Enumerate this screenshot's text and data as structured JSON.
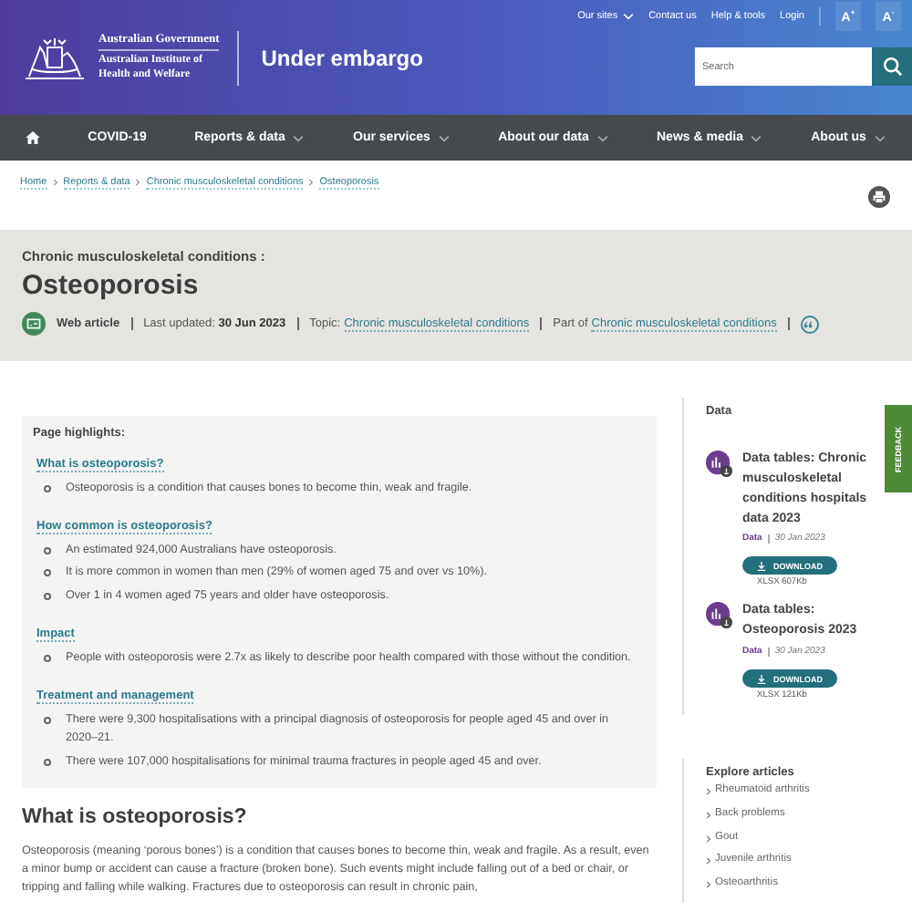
{
  "header": {
    "government": "Australian Government",
    "institute": "Australian Institute of Health and Welfare",
    "banner": "Under embargo",
    "utility_links": [
      {
        "label": "Our sites",
        "dropdown": true
      },
      {
        "label": "Contact us",
        "dropdown": false
      },
      {
        "label": "Help & tools",
        "dropdown": false
      },
      {
        "label": "Login",
        "dropdown": false
      }
    ],
    "text_size_buttons": [
      "A$^{+}$",
      "A$^{-}$"
    ],
    "search": {
      "placeholder": "Search"
    }
  },
  "nav": [
    {
      "label": "COVID-19",
      "dropdown": false
    },
    {
      "label": "Reports & data",
      "dropdown": true
    },
    {
      "label": "Our services",
      "dropdown": true
    },
    {
      "label": "About our data",
      "dropdown": true
    },
    {
      "label": "News & media",
      "dropdown": true
    },
    {
      "label": "About us",
      "dropdown": true
    }
  ],
  "breadcrumb": [
    "Home",
    "Reports & data",
    "Chronic musculoskeletal conditions",
    "Osteoporosis"
  ],
  "title_band": {
    "parent": "Chronic musculoskeletal conditions :",
    "title": "Osteoporosis",
    "type": "Web article",
    "updated_label": "Last updated:",
    "updated": "30 Jun 2023",
    "topic_label": "Topic:",
    "topic": "Chronic musculoskeletal conditions",
    "part_label": "Part of",
    "part": "Chronic musculoskeletal conditions"
  },
  "highlights": {
    "heading": "Page highlights:",
    "sections": [
      {
        "title": "What is osteoporosis?",
        "points": [
          "Osteoporosis is a condition that causes bones to become thin, weak and fragile."
        ]
      },
      {
        "title": "How common is osteoporosis?",
        "points": [
          "An estimated 924,000 Australians have osteoporosis.",
          "It is more common in women than men (29% of women aged 75 and over vs 10%).",
          "Over 1 in 4 women aged 75 years and older have osteoporosis."
        ]
      },
      {
        "title": "Impact",
        "points": [
          "People with osteoporosis were 2.7x as likely to describe poor health compared with those without the condition."
        ]
      },
      {
        "title": "Treatment and management",
        "points": [
          "There were 9,300 hospitalisations with a principal diagnosis of osteoporosis for people aged 45 and over in 2020–21.",
          "There were 107,000 hospitalisations for minimal trauma fractures in people aged 45 and over."
        ]
      }
    ]
  },
  "section": {
    "heading": "What is osteoporosis?",
    "paragraph": "Osteoporosis (meaning ‘porous bones’) is a condition that causes bones to become thin, weak and fragile. As a result, even a minor bump or accident can cause a fracture (broken bone). Such events might include falling out of a bed or chair, or tripping and falling while walking. Fractures due to osteoporosis can result in chronic pain,"
  },
  "sidebar": {
    "data_heading": "Data",
    "data_items": [
      {
        "title": "Data tables: Chronic musculoskeletal conditions hospitals data 2023",
        "type": "Data",
        "date": "30 Jan 2023",
        "button": "DOWNLOAD",
        "file": "XLSX 607Kb"
      },
      {
        "title": "Data tables: Osteoporosis 2023",
        "type": "Data",
        "date": "30 Jan 2023",
        "button": "DOWNLOAD",
        "file": "XLSX 121Kb"
      }
    ],
    "explore_heading": "Explore articles",
    "explore": [
      "Rheumatoid arthritis",
      "Back problems",
      "Gout",
      "Juvenile arthritis",
      "Osteoarthritis"
    ]
  },
  "feedback": "FEEDBACK"
}
